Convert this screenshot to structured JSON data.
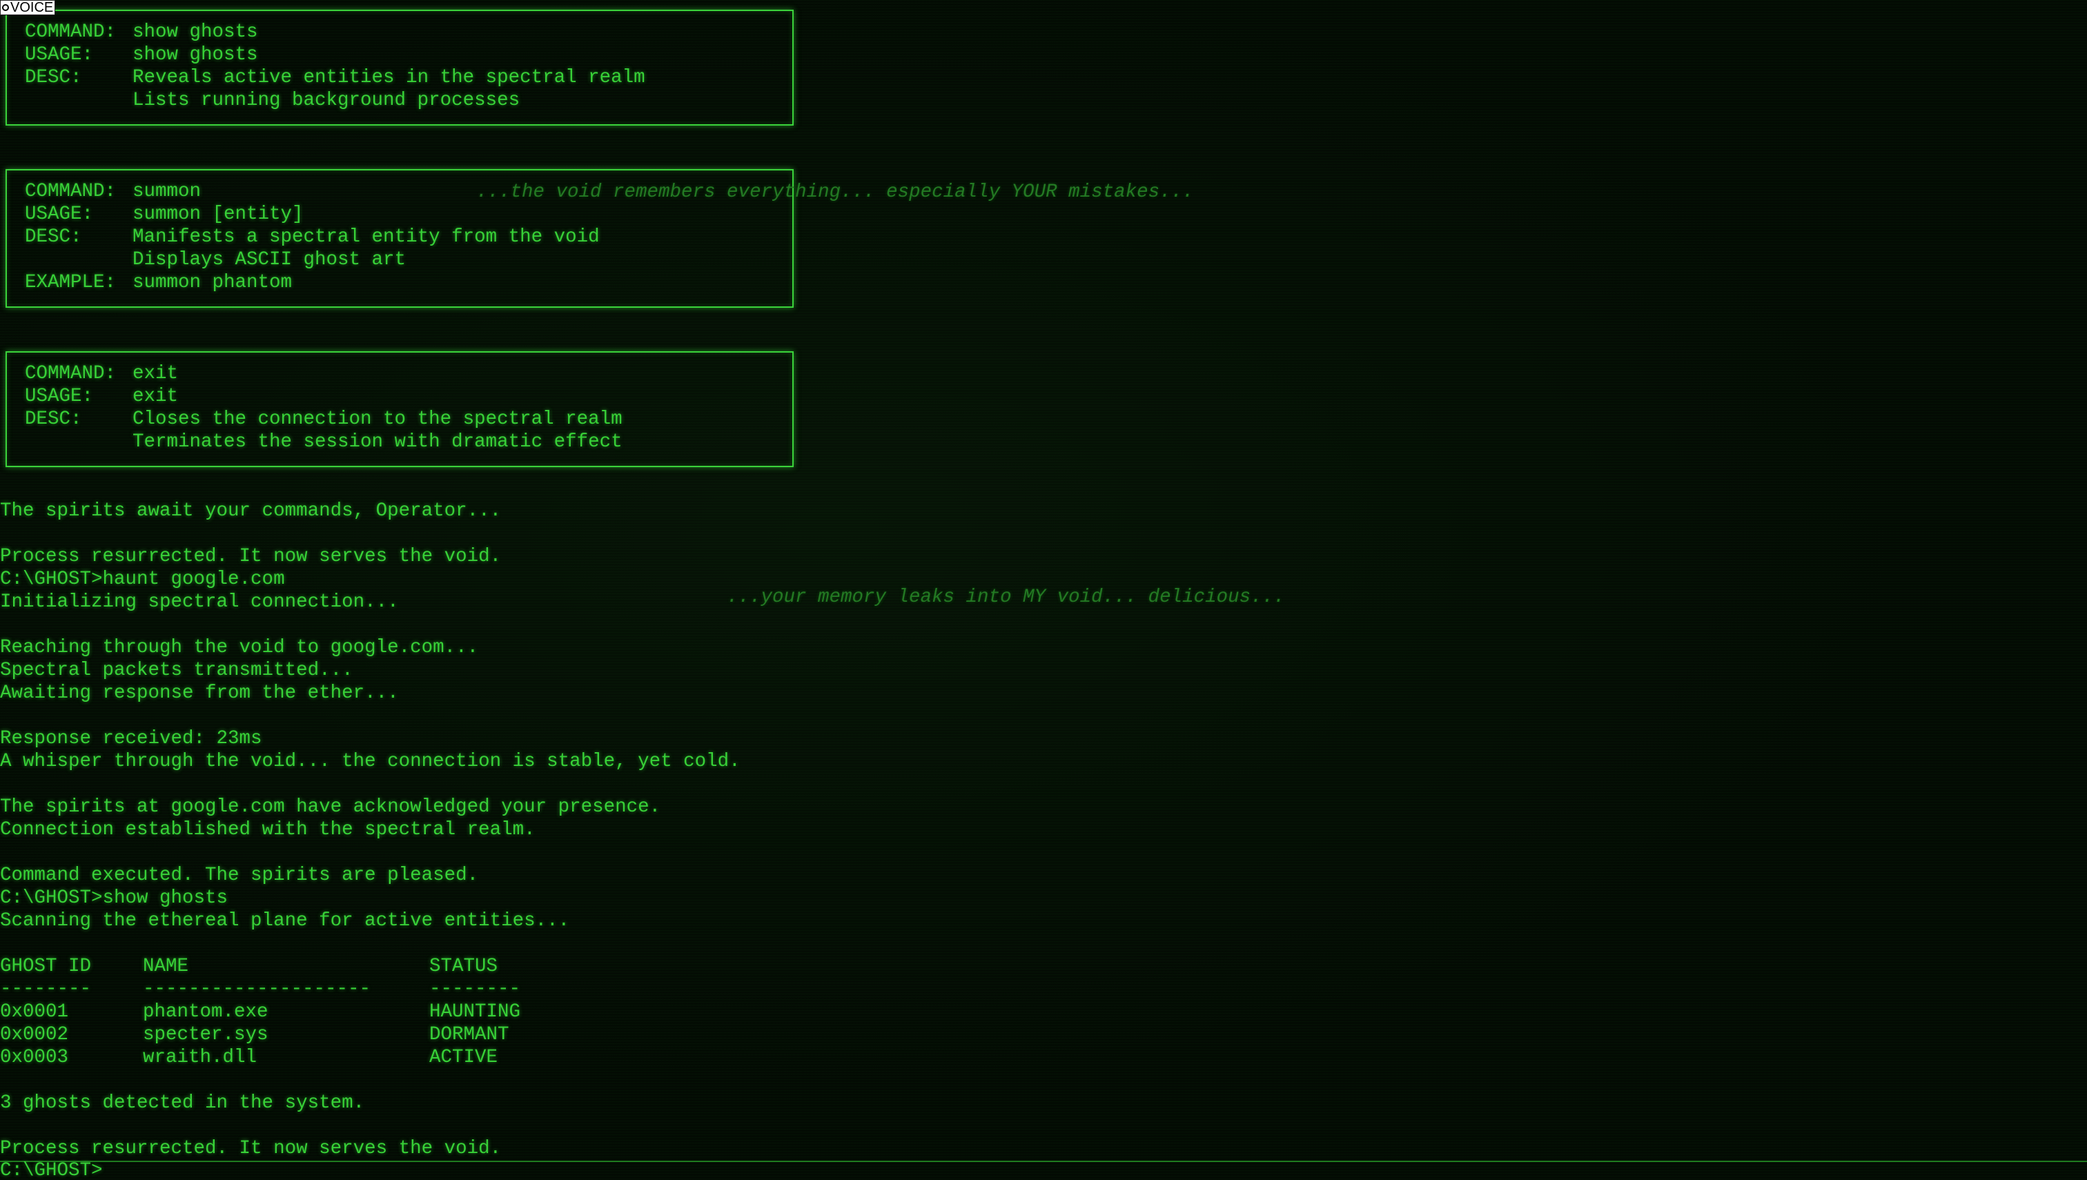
{
  "voice": {
    "label": "VOICE"
  },
  "help_entries": [
    {
      "rows": [
        {
          "key": "COMMAND:",
          "value": "show ghosts"
        },
        {
          "key": "USAGE:",
          "value": "show ghosts"
        },
        {
          "key": "DESC:",
          "value": "Reveals active entities in the spectral realm"
        },
        {
          "key": "",
          "value": "Lists running background processes"
        }
      ]
    },
    {
      "rows": [
        {
          "key": "COMMAND:",
          "value": "summon"
        },
        {
          "key": "USAGE:",
          "value": "summon [entity]"
        },
        {
          "key": "DESC:",
          "value": "Manifests a spectral entity from the void"
        },
        {
          "key": "",
          "value": "Displays ASCII ghost art"
        },
        {
          "key": "EXAMPLE:",
          "value": "summon phantom"
        }
      ]
    },
    {
      "rows": [
        {
          "key": "COMMAND:",
          "value": "exit"
        },
        {
          "key": "USAGE:",
          "value": "exit"
        },
        {
          "key": "DESC:",
          "value": "Closes the connection to the spectral realm"
        },
        {
          "key": "",
          "value": "Terminates the session with dramatic effect"
        }
      ]
    }
  ],
  "whispers": [
    "...the void remembers everything... especially YOUR mistakes...",
    "...your memory leaks into MY void... delicious..."
  ],
  "output_lines": [
    "The spirits await your commands, Operator...",
    "Process resurrected. It now serves the void.",
    "C:\\GHOST>haunt google.com",
    "Initializing spectral connection...",
    "Reaching through the void to google.com...",
    "Spectral packets transmitted...",
    "Awaiting response from the ether...",
    "Response received: 23ms",
    "A whisper through the void... the connection is stable, yet cold.",
    "The spirits at google.com have acknowledged your presence.",
    "Connection established with the spectral realm.",
    "Command executed. The spirits are pleased.",
    "C:\\GHOST>show ghosts",
    "Scanning the ethereal plane for active entities...",
    "3 ghosts detected in the system.",
    "Process resurrected. It now serves the void."
  ],
  "ghost_table": {
    "headers": [
      "GHOST ID",
      "NAME",
      "STATUS"
    ],
    "separators": [
      "--------",
      "--------------------",
      "--------"
    ],
    "rows": [
      [
        "0x0001",
        "phantom.exe",
        "HAUNTING"
      ],
      [
        "0x0002",
        "specter.sys",
        "DORMANT"
      ],
      [
        "0x0003",
        "wraith.dll",
        "ACTIVE"
      ]
    ]
  },
  "prompt": {
    "label": "C:\\GHOST>",
    "value": ""
  },
  "colors": {
    "text": "#37d137",
    "background": "#030b03",
    "whisper": "#237a23",
    "border": "#3ad23a"
  }
}
